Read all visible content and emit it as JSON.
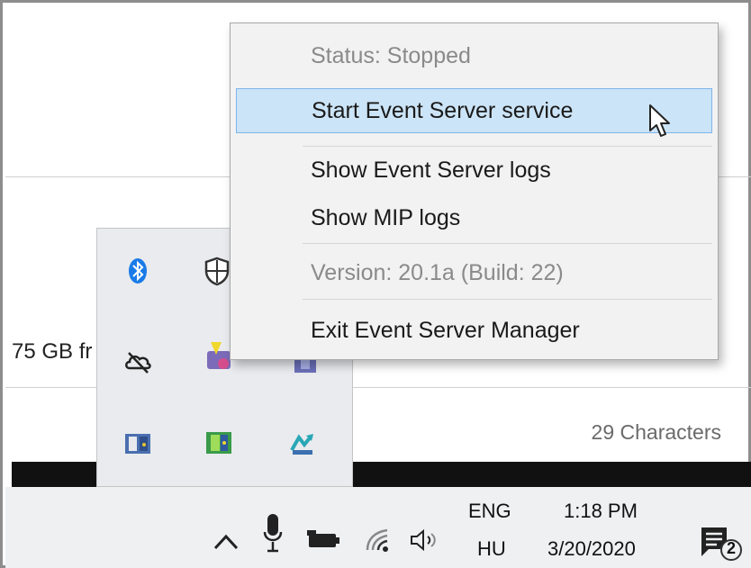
{
  "context_menu": {
    "items": [
      {
        "label": "Status: Stopped",
        "enabled": false
      },
      {
        "label": "Start Event Server service",
        "enabled": true,
        "highlighted": true
      },
      {
        "label": "Show Event Server logs",
        "enabled": true
      },
      {
        "label": "Show MIP logs",
        "enabled": true
      },
      {
        "label": "Version: 20.1a (Build: 22)",
        "enabled": false
      },
      {
        "label": "Exit Event Server Manager",
        "enabled": true
      }
    ],
    "highlight_color": "#cce4f7"
  },
  "background_window": {
    "disk_space_text": "75 GB fr",
    "character_count": "29 Characters"
  },
  "overflow_tray": {
    "icons": [
      "bluetooth-icon",
      "windows-security-icon",
      "onedrive-icon",
      "app-icon-yellow",
      "app-icon-purple",
      "app-icon-door-blue",
      "app-icon-door-green",
      "app-icon-teal"
    ]
  },
  "taskbar": {
    "language": "ENG",
    "layout": "HU",
    "time": "1:18 PM",
    "date": "3/20/2020",
    "notification_count": "2",
    "tray_icons": [
      "chevron-up-icon",
      "microphone-icon",
      "battery-icon",
      "wifi-icon",
      "speaker-icon",
      "action-center-icon"
    ]
  }
}
